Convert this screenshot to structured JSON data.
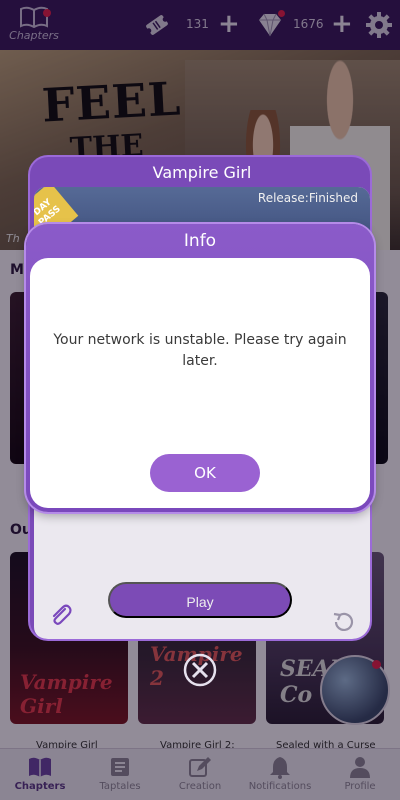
{
  "topbar": {
    "chapters_label": "Chapters",
    "tickets": "131",
    "gems": "1676",
    "plus": "+"
  },
  "banner": {
    "title_line1": "FEEL",
    "title_line2": "THE",
    "caption": "Th"
  },
  "sections": {
    "first_heading": "MY",
    "second_heading": "Ou"
  },
  "story_card": {
    "title": "Vampire Girl",
    "release": "Release:Finished",
    "day_pass": "DAY PASS",
    "play_label": "Play"
  },
  "covers": {
    "cover1_logo": "Vampire Girl",
    "cover2_logo": "Vampire 2",
    "cover3_logo": "SEAL Co"
  },
  "book_titles": [
    "Vampire Girl",
    "Vampire Girl 2:",
    "Sealed with a Curse"
  ],
  "tabs": [
    {
      "label": "Chapters",
      "active": true
    },
    {
      "label": "Taptales",
      "active": false
    },
    {
      "label": "Creation",
      "active": false
    },
    {
      "label": "Notifications",
      "active": false
    },
    {
      "label": "Profile",
      "active": false
    }
  ],
  "dialog": {
    "title": "Info",
    "message": "Your network is unstable. Please try again later.",
    "ok_label": "OK"
  },
  "colors": {
    "accent": "#7a48bc",
    "ok_button": "#9a62d2",
    "badge": "#e0214a"
  }
}
